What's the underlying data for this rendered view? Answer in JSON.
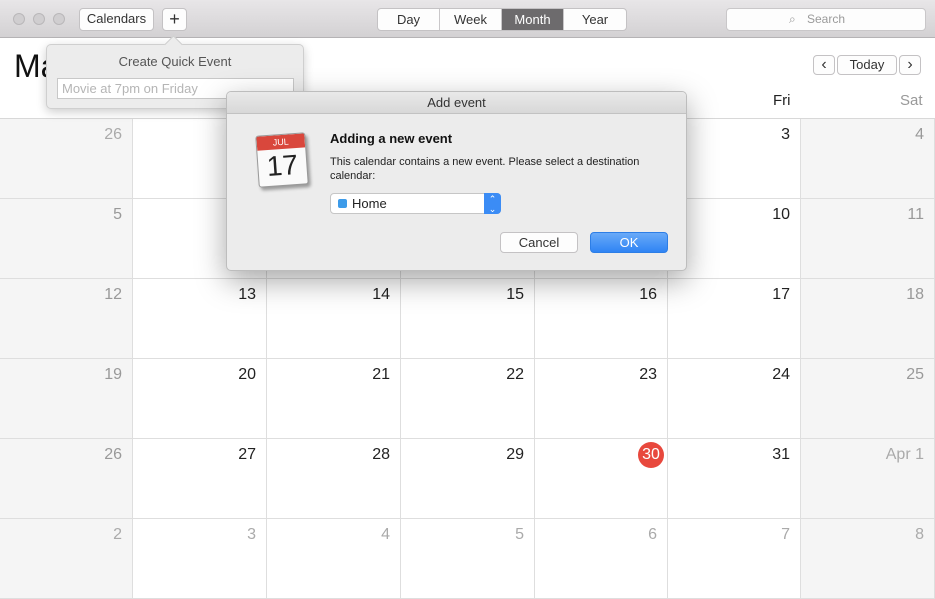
{
  "toolbar": {
    "calendars_label": "Calendars",
    "add_label": "+",
    "views": [
      "Day",
      "Week",
      "Month",
      "Year"
    ],
    "active_view": "Month",
    "search_placeholder": "Search"
  },
  "header": {
    "title": "Ma",
    "nav_prev": "‹",
    "today_label": "Today",
    "nav_next": "›",
    "day_names": [
      "Fri",
      "Sat"
    ]
  },
  "weeks": [
    [
      "26",
      "",
      "",
      "",
      "",
      "3",
      "4"
    ],
    [
      "5",
      "",
      "",
      "",
      "",
      "10",
      "11"
    ],
    [
      "12",
      "13",
      "14",
      "15",
      "16",
      "17",
      "18"
    ],
    [
      "19",
      "20",
      "21",
      "22",
      "23",
      "24",
      "25"
    ],
    [
      "26",
      "27",
      "28",
      "29",
      "30",
      "31",
      "Apr 1"
    ],
    [
      "2",
      "3",
      "4",
      "5",
      "6",
      "7",
      "8"
    ]
  ],
  "today": "30",
  "colors": {
    "today": "#e8483d",
    "accent": "#3b8cf5",
    "home_calendar": "#3d9be9"
  },
  "quick_event": {
    "title": "Create Quick Event",
    "placeholder": "Movie at 7pm on Friday"
  },
  "dialog": {
    "title": "Add event",
    "icon_month": "JUL",
    "icon_day": "17",
    "heading": "Adding a new event",
    "message": "This calendar contains a new event. Please select a destination calendar:",
    "selected_calendar": "Home",
    "cancel_label": "Cancel",
    "ok_label": "OK"
  }
}
